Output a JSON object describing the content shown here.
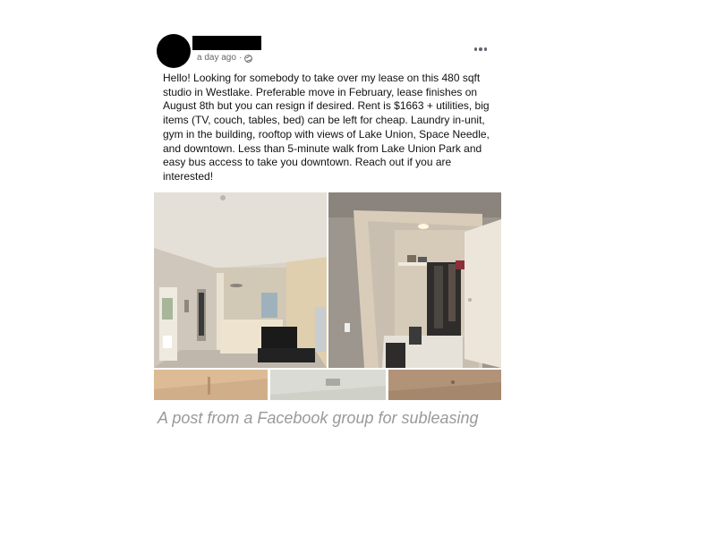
{
  "post": {
    "timestamp": "a day ago",
    "separator": "·",
    "audience_icon": "public-globe-icon",
    "more_icon": "ellipsis-icon",
    "text": "Hello! Looking for somebody to take over my lease on this 480 sqft studio in Westlake. Preferable move in February, lease finishes on August 8th but you can resign if desired. Rent is $1663 + utilities, big items (TV, couch, tables, bed) can be left for cheap. Laundry in-unit, gym in the building, rooftop with views of Lake Union, Space Needle, and downtown. Less than 5-minute walk from Lake Union Park and easy bus access to take you downtown. Reach out if you are interested!"
  },
  "caption": "A post from a Facebook group for subleasing",
  "colors": {
    "meta_text": "#65676b",
    "caption": "#9a9a9a",
    "redaction": "#000000"
  }
}
